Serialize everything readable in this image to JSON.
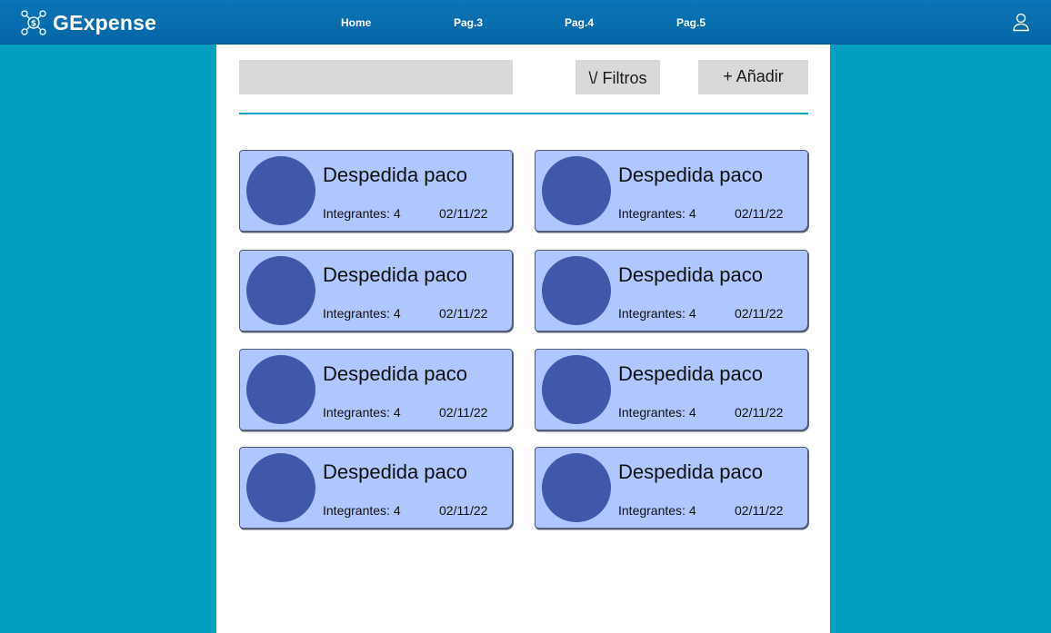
{
  "brand": {
    "name": "GExpense",
    "logo_icon": "network-dollar-icon"
  },
  "nav": {
    "home": "Home",
    "pag3": "Pag.3",
    "pag4": "Pag.4",
    "pag5": "Pag.5"
  },
  "user_icon": "user-icon",
  "toolbar": {
    "search_value": "",
    "filtros_label": "\\/ Filtros",
    "anadir_label": "+ Añadir"
  },
  "groups": [
    {
      "title": "Despedida paco",
      "members": "Integrantes: 4",
      "date": "02/11/22"
    },
    {
      "title": "Despedida paco",
      "members": "Integrantes: 4",
      "date": "02/11/22"
    },
    {
      "title": "Despedida paco",
      "members": "Integrantes: 4",
      "date": "02/11/22"
    },
    {
      "title": "Despedida paco",
      "members": "Integrantes: 4",
      "date": "02/11/22"
    },
    {
      "title": "Despedida paco",
      "members": "Integrantes: 4",
      "date": "02/11/22"
    },
    {
      "title": "Despedida paco",
      "members": "Integrantes: 4",
      "date": "02/11/22"
    },
    {
      "title": "Despedida paco",
      "members": "Integrantes: 4",
      "date": "02/11/22"
    },
    {
      "title": "Despedida paco",
      "members": "Integrantes: 4",
      "date": "02/11/22"
    }
  ],
  "colors": {
    "background": "#049ec0",
    "topbar": "#0a74b6",
    "card": "#b0c6ff",
    "avatar": "#3f58a9",
    "button": "#d9d9d9"
  }
}
